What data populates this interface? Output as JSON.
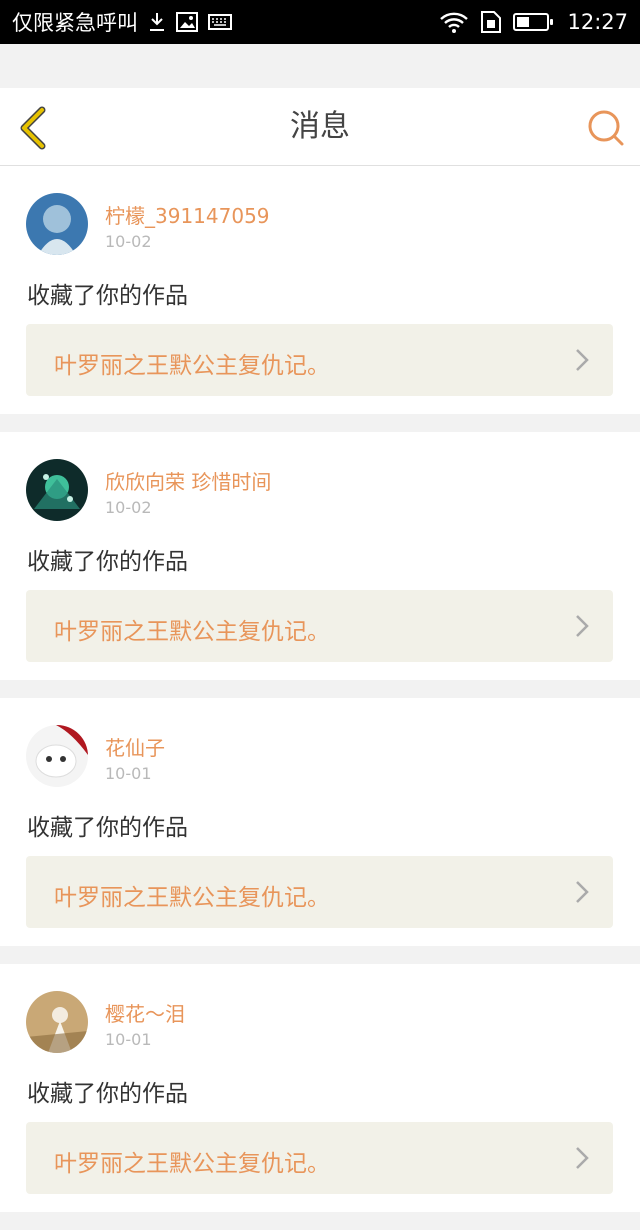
{
  "status_bar": {
    "carrier": "仅限紧急呼叫",
    "time": "12:27",
    "icons": [
      "download-icon",
      "image-icon",
      "keyboard-icon",
      "wifi-icon",
      "sim-icon",
      "battery-icon"
    ]
  },
  "header": {
    "title": "消息",
    "back_icon": "chevron-left-icon",
    "search_icon": "search-icon",
    "accent_color": "#e8955a",
    "back_color": "#e6c200"
  },
  "messages": [
    {
      "user": "柠檬_391147059",
      "date": "10-02",
      "action": "收藏了你的作品",
      "work_title": "叶罗丽之王默公主复仇记。",
      "avatar_colors": [
        "#3c78b0",
        "#9fc1da"
      ]
    },
    {
      "user": "欣欣向荣 珍惜时间",
      "date": "10-02",
      "action": "收藏了你的作品",
      "work_title": "叶罗丽之王默公主复仇记。",
      "avatar_colors": [
        "#0e2b2a",
        "#3fbf9a"
      ]
    },
    {
      "user": "花仙子",
      "date": "10-01",
      "action": "收藏了你的作品",
      "work_title": "叶罗丽之王默公主复仇记。",
      "avatar_colors": [
        "#b01820",
        "#f4f4f4"
      ]
    },
    {
      "user": "樱花～泪",
      "date": "10-01",
      "action": "收藏了你的作品",
      "work_title": "叶罗丽之王默公主复仇记。",
      "avatar_colors": [
        "#c9a876",
        "#8a6a3c"
      ]
    }
  ]
}
